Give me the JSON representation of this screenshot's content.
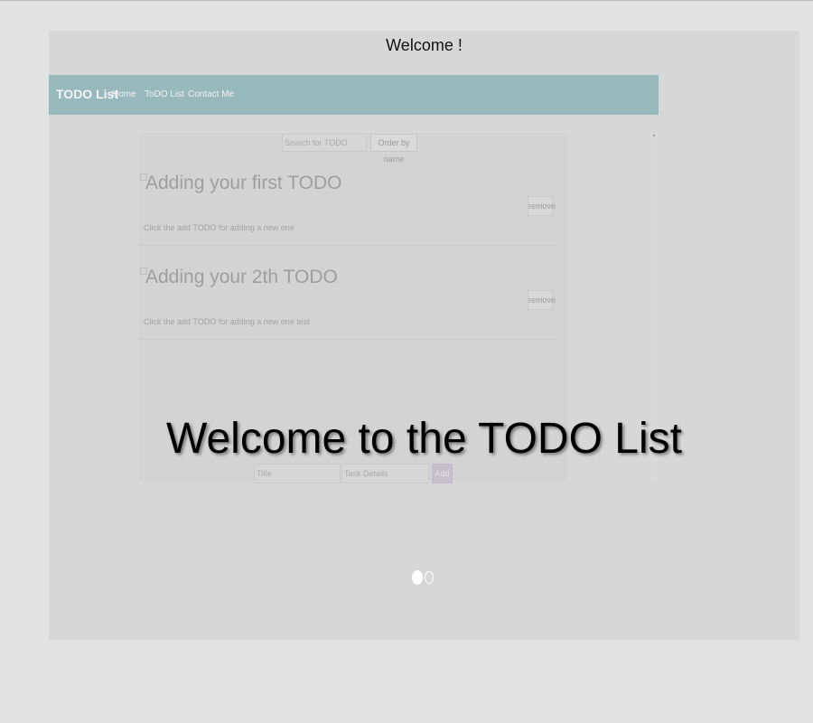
{
  "slide": {
    "welcome_text": "Welcome !",
    "headline": "Welcome to the TODO List"
  },
  "navbar": {
    "brand": "TODO List",
    "links": [
      "Home",
      "ToDO List",
      "Contact Me"
    ]
  },
  "toolbar": {
    "search_placeholder": "Search for TODO",
    "order_button": "Order by name"
  },
  "todos": [
    {
      "title": "Adding your first TODO",
      "description": "Click the add TODO for adding a new one",
      "remove_label": "remove"
    },
    {
      "title": "Adding your 2th TODO",
      "description": "Click the add TODO for adding a new one test",
      "remove_label": "remove"
    }
  ],
  "form": {
    "title_placeholder": "Title",
    "details_placeholder": "Task Details",
    "add_label": "Add"
  },
  "carousel": {
    "slide_count": 2,
    "active_index": 0
  },
  "colors": {
    "navbar": "#98b9bc",
    "slide_background": "#d7d7d7",
    "page_background": "#e2e2e2"
  },
  "icons": [
    "checkbox-icon",
    "scroll-up-icon"
  ]
}
